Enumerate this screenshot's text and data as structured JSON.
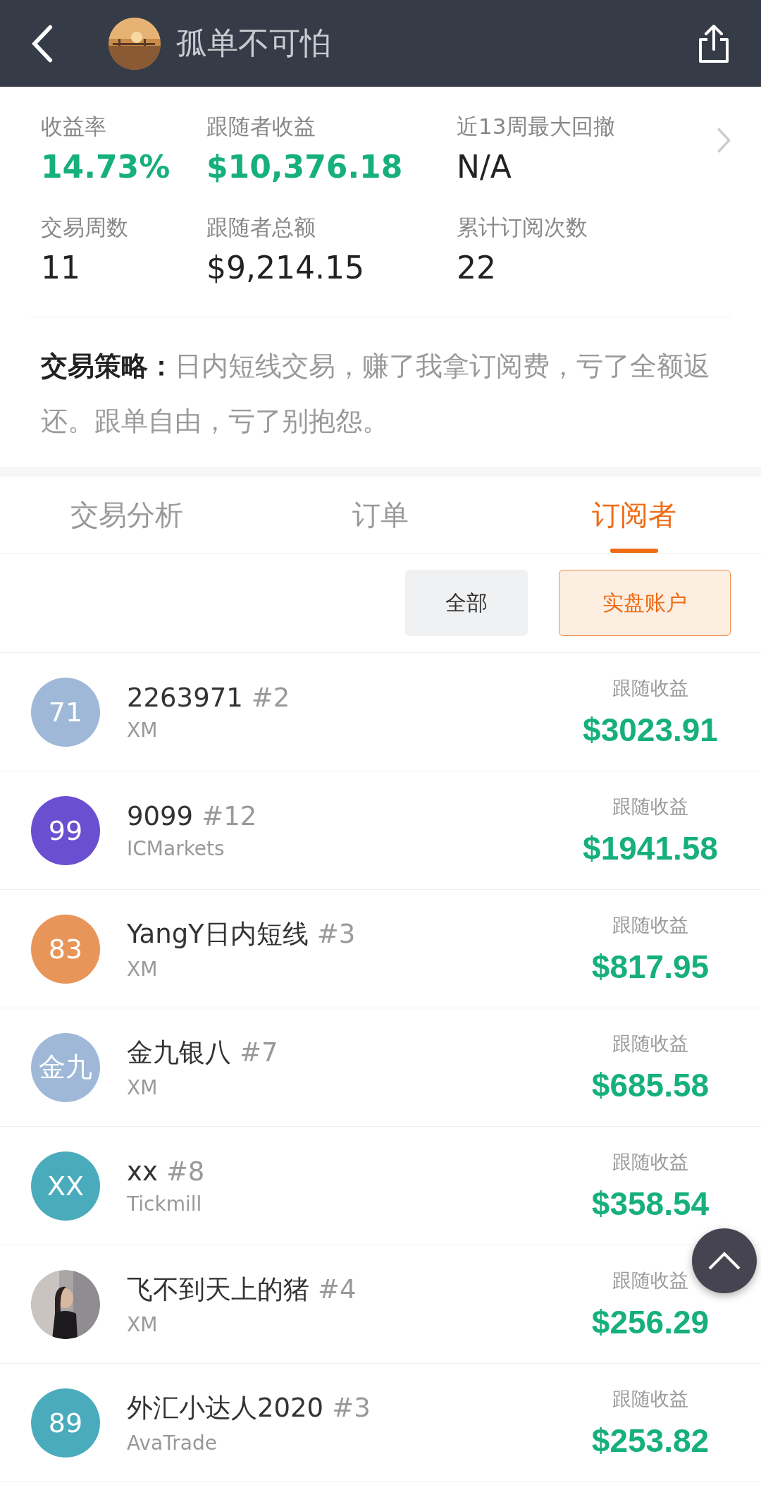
{
  "header": {
    "title": "孤单不可怕"
  },
  "stats": [
    {
      "label": "收益率",
      "value": "14.73%",
      "positive": true
    },
    {
      "label": "跟随者收益",
      "value": "$10,376.18",
      "positive": true
    },
    {
      "label": "近13周最大回撤",
      "value": "N/A",
      "positive": false
    },
    {
      "label": "交易周数",
      "value": "11",
      "positive": false
    },
    {
      "label": "跟随者总额",
      "value": "$9,214.15",
      "positive": false
    },
    {
      "label": "累计订阅次数",
      "value": "22",
      "positive": false
    }
  ],
  "strategy": {
    "label": "交易策略：",
    "text": "日内短线交易，赚了我拿订阅费，亏了全额返还。跟单自由，亏了别抱怨。"
  },
  "tabs": [
    {
      "label": "交易分析",
      "selected": false
    },
    {
      "label": "订单",
      "selected": false
    },
    {
      "label": "订阅者",
      "selected": true
    }
  ],
  "filters": [
    {
      "label": "全部",
      "selected": false
    },
    {
      "label": "实盘账户",
      "selected": true
    }
  ],
  "subscribers": [
    {
      "avatar": {
        "kind": "initials",
        "text": "71",
        "color": "#9fb8d8"
      },
      "name": "2263971",
      "rank": "#2",
      "broker": "XM",
      "earnings_label": "跟随收益",
      "earnings": "$3023.91"
    },
    {
      "avatar": {
        "kind": "initials",
        "text": "99",
        "color": "#6a4fd0"
      },
      "name": "9099",
      "rank": "#12",
      "broker": "ICMarkets",
      "earnings_label": "跟随收益",
      "earnings": "$1941.58"
    },
    {
      "avatar": {
        "kind": "initials",
        "text": "83",
        "color": "#e8955a"
      },
      "name": "YangY日内短线",
      "rank": "#3",
      "broker": "XM",
      "earnings_label": "跟随收益",
      "earnings": "$817.95"
    },
    {
      "avatar": {
        "kind": "initials",
        "text": "金九",
        "color": "#9fb8d8"
      },
      "name": "金九银八",
      "rank": "#7",
      "broker": "XM",
      "earnings_label": "跟随收益",
      "earnings": "$685.58"
    },
    {
      "avatar": {
        "kind": "initials",
        "text": "XX",
        "color": "#4aabbc"
      },
      "name": "xx",
      "rank": "#8",
      "broker": "Tickmill",
      "earnings_label": "跟随收益",
      "earnings": "$358.54"
    },
    {
      "name": "飞不到天上的猪",
      "rank": "#4",
      "broker": "XM",
      "earnings_label": "跟随收益",
      "earnings": "$256.29"
    },
    {
      "avatar": {
        "kind": "initials",
        "text": "89",
        "color": "#4aabbc"
      },
      "name": "外汇小达人2020",
      "rank": "#3",
      "broker": "AvaTrade",
      "earnings_label": "跟随收益",
      "earnings": "$253.82"
    }
  ]
}
